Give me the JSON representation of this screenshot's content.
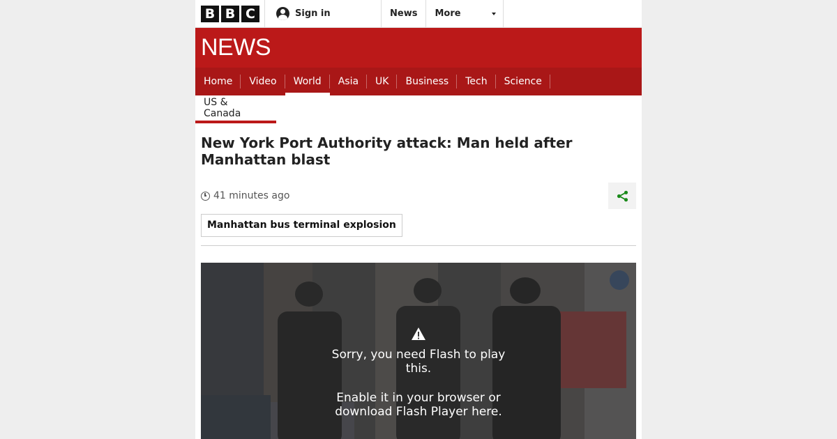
{
  "masthead": {
    "logo_letters": [
      "B",
      "B",
      "C"
    ],
    "signin_label": "Sign in",
    "nav": [
      "News",
      "More"
    ]
  },
  "banner": {
    "wordmark": "NEWS",
    "color": "#bb1919"
  },
  "section_nav": {
    "tabs": [
      "Home",
      "Video",
      "World",
      "Asia",
      "UK",
      "Business",
      "Tech",
      "Science"
    ],
    "active": "World"
  },
  "sub_nav": {
    "label": "US & Canada"
  },
  "article": {
    "headline": "New York Port Authority attack: Man held after Manhattan blast",
    "timestamp": "41 minutes ago",
    "tag": "Manhattan bus terminal explosion"
  },
  "media": {
    "message_line1": "Sorry, you need Flash to play this.",
    "message_line2": "Enable it in your browser or download Flash Player here."
  },
  "colors": {
    "accent": "#bb1919",
    "share": "#1a8a1a"
  }
}
